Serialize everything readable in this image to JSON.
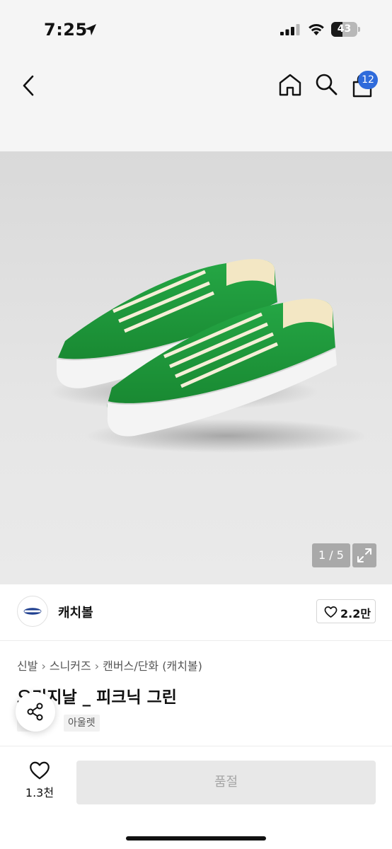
{
  "status_bar": {
    "time": "7:25",
    "battery_level": "43",
    "battery_fraction": 0.43,
    "icons": [
      "location-arrow-icon",
      "cellular-signal-icon",
      "wifi-icon",
      "battery-icon"
    ]
  },
  "nav": {
    "back_icon": "chevron-left-icon",
    "home_icon": "home-icon",
    "search_icon": "search-icon",
    "cart_icon": "shopping-bag-icon",
    "cart_count": "12"
  },
  "gallery": {
    "pager": "1 / 5",
    "expand_icon": "expand-arrows-icon"
  },
  "brand": {
    "name": "캐치볼",
    "like_count": "2.2만"
  },
  "breadcrumb": [
    "신발",
    "스니커즈",
    "캔버스/단화 (캐치볼)"
  ],
  "product": {
    "title": "오리지날 _ 피크닉 그린",
    "tags": [
      "품",
      "아울렛"
    ]
  },
  "bottom_bar": {
    "wish_count": "1.3천",
    "buy_button": "품절"
  },
  "colors": {
    "accent_badge": "#2f6bdb",
    "shoe_green": "#1f9a3c",
    "soldout_bg": "#e8e8e8",
    "soldout_text": "#a6a6a6"
  }
}
